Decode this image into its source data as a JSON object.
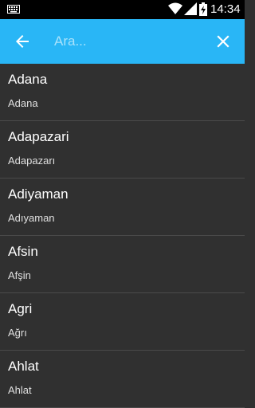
{
  "status_bar": {
    "time": "14:34",
    "battery_level": "charging"
  },
  "search": {
    "placeholder": "Ara...",
    "value": ""
  },
  "results": [
    {
      "title": "Adana",
      "subtitle": "Adana"
    },
    {
      "title": "Adapazari",
      "subtitle": "Adapazarı"
    },
    {
      "title": "Adiyaman",
      "subtitle": "Adıyaman"
    },
    {
      "title": "Afsin",
      "subtitle": "Afşin"
    },
    {
      "title": "Agri",
      "subtitle": "Ağrı"
    },
    {
      "title": "Ahlat",
      "subtitle": "Ahlat"
    }
  ],
  "colors": {
    "toolbar": "#29b6f6",
    "background": "#303030",
    "divider": "#4a4a4a"
  }
}
